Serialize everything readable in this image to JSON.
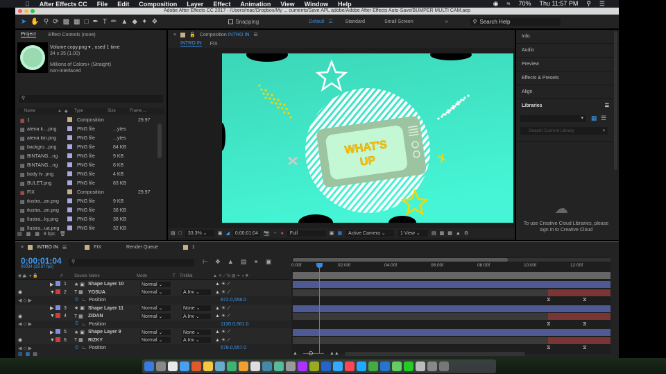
{
  "menubar": {
    "items": [
      "After Effects CC",
      "File",
      "Edit",
      "Composition",
      "Layer",
      "Effect",
      "Animation",
      "View",
      "Window",
      "Help"
    ],
    "battery": "70%",
    "clock": "Thu 11:57 PM"
  },
  "window": {
    "title": "Adobe After Effects CC 2017 - /Users/mac/Dropbox/My  ... cuments/Save APL adobe/Adobe After Effects Auto-Save/BUMPER MULTI CAM.aep"
  },
  "toolbar": {
    "snapping": "Snapping",
    "workspaces": [
      "Default",
      "Standard",
      "Small Screen"
    ],
    "search_help": "Search Help"
  },
  "project": {
    "tabs": [
      "Project",
      "Effect Controls (none)"
    ],
    "preview": {
      "name": "Volume copy.png ▾ , used 1 time",
      "dims": "34 x 35 (1.00)",
      "colors": "Millions of Colors+ (Straight)",
      "interlace": "non-interlaced"
    },
    "columns": [
      "Name",
      "Type",
      "Size",
      "Frame ..."
    ],
    "items": [
      {
        "name": "1",
        "type": "Composition",
        "size": "",
        "frame": "29.97",
        "kind": "comp"
      },
      {
        "name": "atena k....png",
        "type": "PNG file",
        "size": "...ytes",
        "frame": "",
        "kind": "png"
      },
      {
        "name": "atena kiri.png",
        "type": "PNG file",
        "size": "...ytes",
        "frame": "",
        "kind": "png"
      },
      {
        "name": "backgro...png",
        "type": "PNG file",
        "size": "84 KB",
        "frame": "",
        "kind": "png"
      },
      {
        "name": "BINTANG...ng",
        "type": "PNG file",
        "size": "9 KB",
        "frame": "",
        "kind": "png"
      },
      {
        "name": "BINTANG...ng",
        "type": "PNG file",
        "size": "8 KB",
        "frame": "",
        "kind": "png"
      },
      {
        "name": "body tv .png",
        "type": "PNG file",
        "size": "4 KB",
        "frame": "",
        "kind": "png"
      },
      {
        "name": "BULET.png",
        "type": "PNG file",
        "size": "83 KB",
        "frame": "",
        "kind": "png"
      },
      {
        "name": "FIX",
        "type": "Composition",
        "size": "",
        "frame": "29.97",
        "kind": "comp"
      },
      {
        "name": "ilustra...an.png",
        "type": "PNG file",
        "size": "9 KB",
        "frame": "",
        "kind": "png"
      },
      {
        "name": "ilustra...an.png",
        "type": "PNG file",
        "size": "38 KB",
        "frame": "",
        "kind": "png"
      },
      {
        "name": "Ilustra...ky.png",
        "type": "PNG file",
        "size": "38 KB",
        "frame": "",
        "kind": "png"
      },
      {
        "name": "Ilustra...ua.png",
        "type": "PNG file",
        "size": "32 KB",
        "frame": "",
        "kind": "png"
      }
    ],
    "bpc": "8 bpc"
  },
  "viewer": {
    "tab_prefix": "Composition",
    "tab_name": "INTRO IN",
    "breadcrumbs": [
      "INTRO IN",
      "FIX"
    ],
    "artwork_text": [
      "WHAT'S",
      "UP"
    ],
    "controls": {
      "zoom": "33.3%",
      "timecode": "0;00;01;04",
      "resolution": "Full",
      "camera": "Active Camera",
      "views": "1 View"
    }
  },
  "right_panels": {
    "items": [
      "Info",
      "Audio",
      "Preview",
      "Effects & Presets",
      "Align"
    ],
    "libraries": "Libraries",
    "search_placeholder": "Search Current Library",
    "signin": "To use Creative Cloud Libraries, please sign in to Creative Cloud"
  },
  "timeline": {
    "tabs": [
      "INTRO IN",
      "FIX",
      "Render Queue",
      "1"
    ],
    "timecode": "0;00;01;04",
    "frame_info": "00034 (29.97 fps)",
    "columns": {
      "num": "#",
      "source": "Source Name",
      "mode": "Mode",
      "t": "T",
      "trkmat": "TrkMat"
    },
    "ruler": [
      "0:00f",
      "02:00f",
      "04:00f",
      "06:00f",
      "08:00f",
      "10:00f",
      "12:00f"
    ],
    "layers": [
      {
        "num": "1",
        "name": "Shape Layer 10",
        "type": "shape",
        "mode": "Normal",
        "trkmat": "",
        "color": "#7b8ee8"
      },
      {
        "num": "2",
        "name": "YOSUA",
        "type": "text",
        "mode": "Normal",
        "trkmat": "A.Inv",
        "color": "#d23b3b",
        "prop": "Position",
        "value": "872.0,558.0"
      },
      {
        "num": "3",
        "name": "Shape Layer 11",
        "type": "shape",
        "mode": "Normal",
        "trkmat": "None",
        "color": "#7b8ee8"
      },
      {
        "num": "4",
        "name": "ZIDAN",
        "type": "text",
        "mode": "Normal",
        "trkmat": "A.Inv",
        "color": "#d23b3b",
        "prop": "Position",
        "value": "1130.0,561.0"
      },
      {
        "num": "5",
        "name": "Shape Layer 9",
        "type": "shape",
        "mode": "Normal",
        "trkmat": "None",
        "color": "#7b8ee8"
      },
      {
        "num": "6",
        "name": "RIZKY",
        "type": "text",
        "mode": "Normal",
        "trkmat": "A.Inv",
        "color": "#d23b3b",
        "prop": "Position",
        "value": "578.0,557.0"
      }
    ]
  },
  "colors": {
    "accent": "#2d8ceb",
    "canvas": "#3fe0c0",
    "shape_bar": "#4f5a94",
    "text_bar": "#7a3535"
  }
}
